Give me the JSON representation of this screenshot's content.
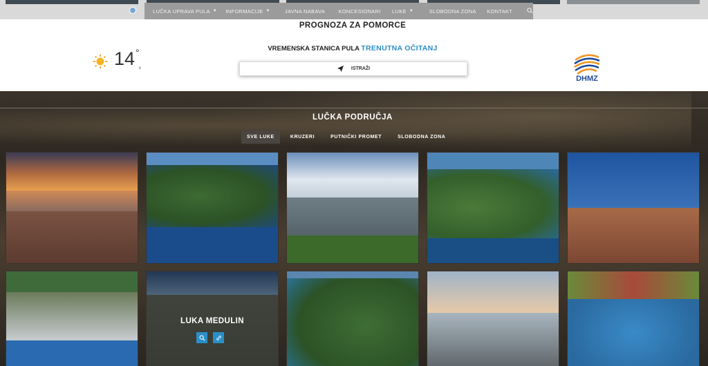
{
  "nav": {
    "items": [
      {
        "label": "LUČKA UPRAVA PULA",
        "has_dropdown": true
      },
      {
        "label": "INFORMACIJE",
        "has_dropdown": true
      },
      {
        "label": "JAVNA NABAVA",
        "has_dropdown": false
      },
      {
        "label": "KONCESIONARI",
        "has_dropdown": false
      },
      {
        "label": "LUKE",
        "has_dropdown": true
      },
      {
        "label": "SLOBODNA ZONA",
        "has_dropdown": false
      },
      {
        "label": "KONTAKT",
        "has_dropdown": false
      }
    ],
    "search_icon": "search-icon"
  },
  "weather": {
    "title": "PROGNOZA ZA POMORCE",
    "temperature": "14",
    "degree_symbol": "°",
    "unit": "c",
    "icon": "sun-icon",
    "station_text": "VREMENSKA STANICA PULA",
    "station_link": "TRENUTNA OČITANJ",
    "search_button": "ISTRAŽI",
    "logo_text": "DHMZ"
  },
  "ports": {
    "title": "LUČKA PODRUČJA",
    "filters": [
      {
        "label": "SVE LUKE",
        "active": true
      },
      {
        "label": "KRUZERI",
        "active": false
      },
      {
        "label": "PUTNIČKI PROMET",
        "active": false
      },
      {
        "label": "SLOBODNA ZONA",
        "active": false
      }
    ],
    "hovered_tile_label": "LUKA MEDULIN"
  },
  "colors": {
    "accent": "#2a8fc8",
    "nav_bg": "#9b9b9b",
    "logo_blue": "#1d4a9a"
  }
}
